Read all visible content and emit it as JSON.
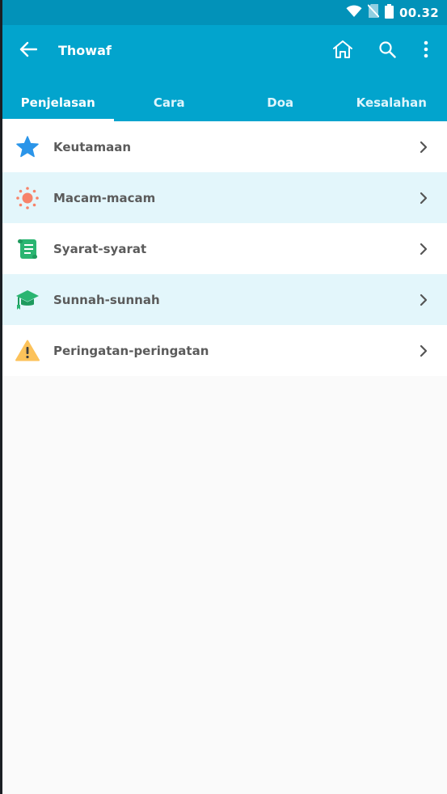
{
  "status_bar": {
    "time": "00.32",
    "icons": [
      "wifi-icon",
      "no-sim-icon",
      "battery-icon"
    ]
  },
  "app_bar": {
    "title": "Thowaf",
    "actions": [
      "back-arrow-icon",
      "home-icon",
      "search-icon",
      "more-vert-icon"
    ],
    "colors": {
      "background": "#02a4cd",
      "status_bar": "#0292b9"
    }
  },
  "tabs": [
    {
      "label": "Penjelasan",
      "active": true
    },
    {
      "label": "Cara",
      "active": false
    },
    {
      "label": "Doa",
      "active": false
    },
    {
      "label": "Kesalahan",
      "active": false
    }
  ],
  "list": {
    "items": [
      {
        "label": "Keutamaan",
        "icon": "star-icon",
        "icon_color": "#2b95e9"
      },
      {
        "label": "Macam-macam",
        "icon": "sun-icon",
        "icon_color": "#f7836a"
      },
      {
        "label": "Syarat-syarat",
        "icon": "scroll-icon",
        "icon_color": "#2ab571"
      },
      {
        "label": "Sunnah-sunnah",
        "icon": "graduation-cap-icon",
        "icon_color": "#2ab571"
      },
      {
        "label": "Peringatan-peringatan",
        "icon": "warning-icon",
        "icon_color": "#fcc25a"
      }
    ]
  }
}
